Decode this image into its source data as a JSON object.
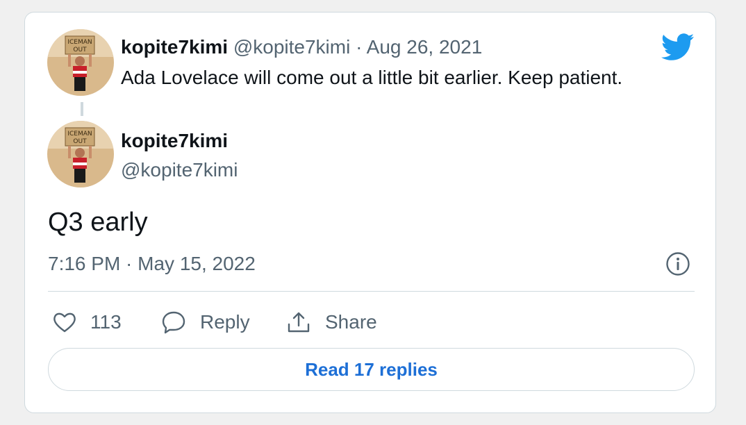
{
  "quoted": {
    "display_name": "kopite7kimi",
    "handle": "@kopite7kimi",
    "separator": "·",
    "date": "Aug 26, 2021",
    "text": "Ada Lovelace will come out a little bit earlier. Keep patient."
  },
  "main": {
    "display_name": "kopite7kimi",
    "handle": "@kopite7kimi",
    "text": "Q3 early",
    "timestamp": "7:16 PM · May 15, 2022"
  },
  "avatar_sign": {
    "line1": "ICEMAN",
    "line2": "OUT"
  },
  "actions": {
    "like_count": "113",
    "reply_label": "Reply",
    "share_label": "Share",
    "read_replies_label": "Read 17 replies"
  },
  "icons": {
    "brand": "twitter-bird-icon",
    "info": "info-icon",
    "like": "heart-icon",
    "reply": "speech-bubble-icon",
    "share": "share-icon"
  },
  "colors": {
    "brand_blue": "#1d9bf0",
    "link_blue": "#1d6fd6",
    "muted_text": "#536471",
    "border": "#cfd9de"
  }
}
